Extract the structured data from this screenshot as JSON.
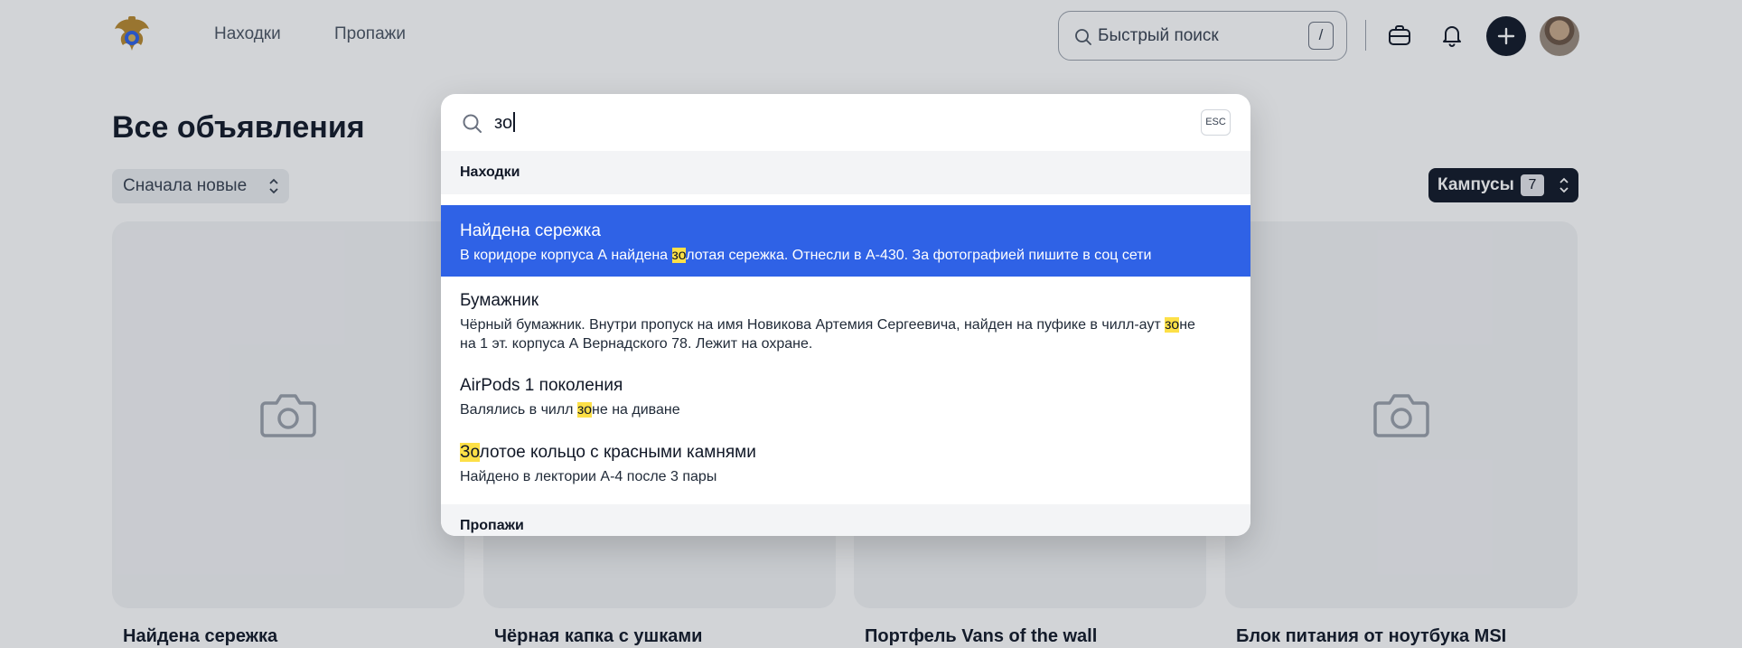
{
  "header": {
    "nav": [
      "Находки",
      "Пропажи"
    ],
    "search_placeholder": "Быстрый поиск",
    "search_shortcut": "/"
  },
  "main": {
    "title": "Все объявления",
    "sort_label": "Сначала новые",
    "campus_label": "Кампусы",
    "campus_count": "7",
    "cards": [
      {
        "title": "Найдена сережка"
      },
      {
        "title": "Чёрная капка с ушками"
      },
      {
        "title": "Портфель Vans of the wall"
      },
      {
        "title": "Блок питания от ноутбука MSI"
      }
    ]
  },
  "search_modal": {
    "query": "зо",
    "esc_label": "ESC",
    "sections": [
      {
        "heading": "Находки",
        "results": [
          {
            "title": "Найдена сережка",
            "desc_before": "В коридоре корпуса А найдена ",
            "desc_match": "зо",
            "desc_after": "лотая сережка. Отнесли в А-430. За фотографией пишите в соц сети",
            "active": true
          },
          {
            "title": "Бумажник",
            "desc_before": "Чёрный бумажник. Внутри пропуск на имя Новикова Артемия Сергеевича, найден на пуфике в чилл-аут ",
            "desc_match": "зо",
            "desc_after": "не на 1 эт. корпуса А Вернадского 78. Лежит на охране.",
            "active": false
          },
          {
            "title": "AirPods 1 поколения",
            "desc_before": "Валялись в чилл ",
            "desc_match": "зо",
            "desc_after": "не на диване",
            "active": false
          },
          {
            "title_match": "Зо",
            "title_after": "лотое кольцо с красными камнями",
            "desc": "Найдено в лектории А-4 после 3 пары",
            "active": false
          }
        ]
      },
      {
        "heading": "Пропажи"
      }
    ]
  },
  "colors": {
    "accent": "#2f62e6",
    "highlight": "#fde047",
    "dark": "#111827"
  }
}
